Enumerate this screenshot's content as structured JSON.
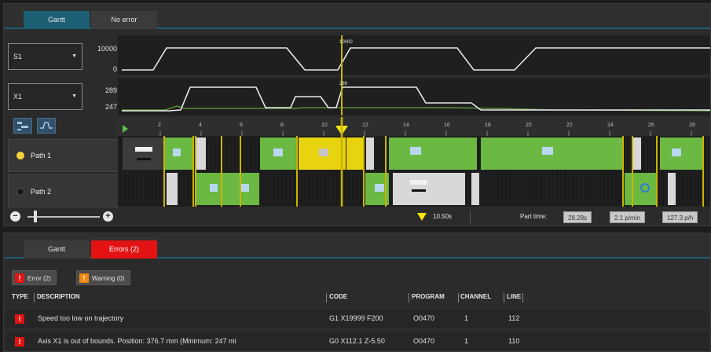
{
  "top_panel": {
    "tabs": [
      {
        "label": "Gantt"
      },
      {
        "label": "No error"
      }
    ],
    "signal_selectors": [
      {
        "value": "S1",
        "axis_max": "10000",
        "axis_min": "0",
        "marker_value": "10000"
      },
      {
        "value": "X1",
        "axis_max": "289",
        "axis_min": "247",
        "marker_value": "289"
      }
    ],
    "ruler_ticks": [
      "2",
      "4",
      "6",
      "8",
      "10",
      "12",
      "14",
      "16",
      "18",
      "20",
      "22",
      "24",
      "26",
      "28"
    ],
    "paths": [
      {
        "label": "Path 1",
        "dot_color": "#f5d23c"
      },
      {
        "label": "Path 2",
        "dot_color": "#1a1a1a"
      }
    ],
    "footer": {
      "cursor_time": "10.50s",
      "part_time_label": "Part time:",
      "part_time": "28.28s",
      "rate_min": "2.1 p/min",
      "rate_hour": "127.3 p/h"
    },
    "colors": {
      "accent": "#1d5f73",
      "green": "#6bb843",
      "yellow": "#e8d30f",
      "marker": "#c9b400"
    }
  },
  "bottom_panel": {
    "tabs": [
      {
        "label": "Gantt"
      },
      {
        "label": "Errors (2)"
      }
    ],
    "filters": [
      {
        "label": "Error (2)",
        "color": "#e31313"
      },
      {
        "label": "Warning (0)",
        "color": "#f0890f"
      }
    ],
    "columns": [
      "TYPE",
      "DESCRIPTION",
      "CODE",
      "PROGRAM",
      "CHANNEL",
      "LINE"
    ],
    "rows": [
      {
        "type_icon": "error-icon",
        "description": "Speed too low on trajectory",
        "code": "G1 X19999 F200",
        "program": "O0470",
        "channel": "1",
        "line": "112"
      },
      {
        "type_icon": "error-icon",
        "description": "Axis X1 is out of bounds. Position: 376.7 mm (Minimum: 247 mi",
        "code": "G0 X112.1 Z-5.50",
        "program": "O0470",
        "channel": "1",
        "line": "110"
      }
    ]
  }
}
